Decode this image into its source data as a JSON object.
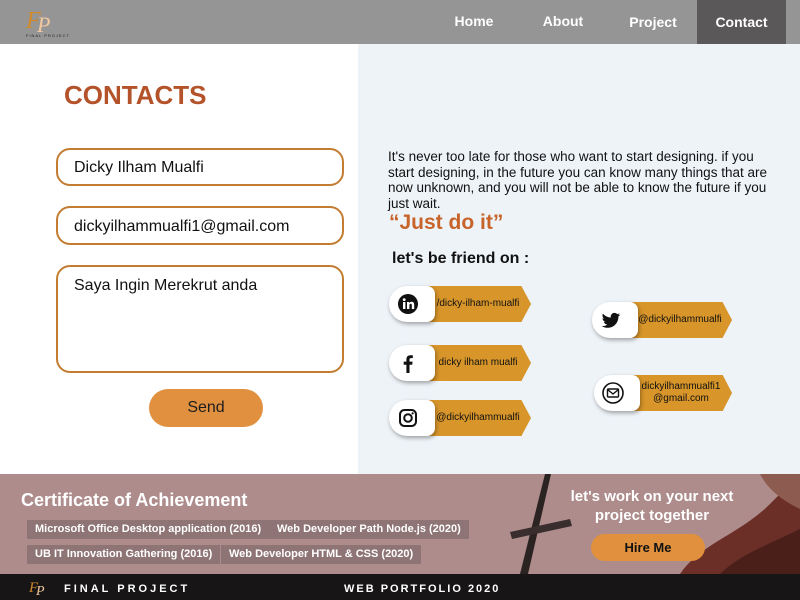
{
  "header": {
    "logo_text": "FINAL PROJECT",
    "nav": {
      "home": "Home",
      "about": "About",
      "project": "Project",
      "contact": "Contact"
    }
  },
  "contact_form": {
    "title": "CONTACTS",
    "name_value": "Dicky Ilham Mualfi",
    "email_value": "dickyilhammualfi1@gmail.com",
    "message_value": "Saya Ingin Merekrut anda",
    "send_label": "Send"
  },
  "intro": {
    "paragraph": "It's never too late for those who want to start designing. if you start designing, in the future you can know many things that are now unknown, and you will not be able to know the future if you just wait.",
    "quote": "“Just do it”",
    "friend_heading": "let's be friend on :"
  },
  "social": {
    "linkedin": {
      "icon": "linkedin-icon",
      "label": "/dicky-ilham-mualfi"
    },
    "facebook": {
      "icon": "facebook-icon",
      "label": "dicky ilham mualfi"
    },
    "instagram": {
      "icon": "instagram-icon",
      "label": "@dickyilhammualfi"
    },
    "twitter": {
      "icon": "twitter-icon",
      "label": "@dickyilhammualfi"
    },
    "gmail": {
      "icon": "gmail-icon",
      "label_line1": "dickyilhammualfi1",
      "label_line2": "@gmail.com"
    }
  },
  "certificates": {
    "title": "Certificate of Achievement",
    "items": [
      "Microsoft Office Desktop application (2016)",
      "Web Developer Path Node.js (2020)",
      "UB IT Innovation Gathering (2016)",
      "Web Developer HTML & CSS (2020)"
    ]
  },
  "cta": {
    "text_line1": "let's work on your next",
    "text_line2": "project together",
    "button_label": "Hire Me"
  },
  "footer": {
    "left": "FINAL PROJECT",
    "right": "WEB PORTFOLIO 2020"
  },
  "colors": {
    "accent": "#b4522a",
    "orange": "#e0903f",
    "header_bg": "#959595",
    "active_nav": "#5a5858",
    "bottom_bg": "#ae8c8c",
    "footer_bg": "#171515"
  }
}
